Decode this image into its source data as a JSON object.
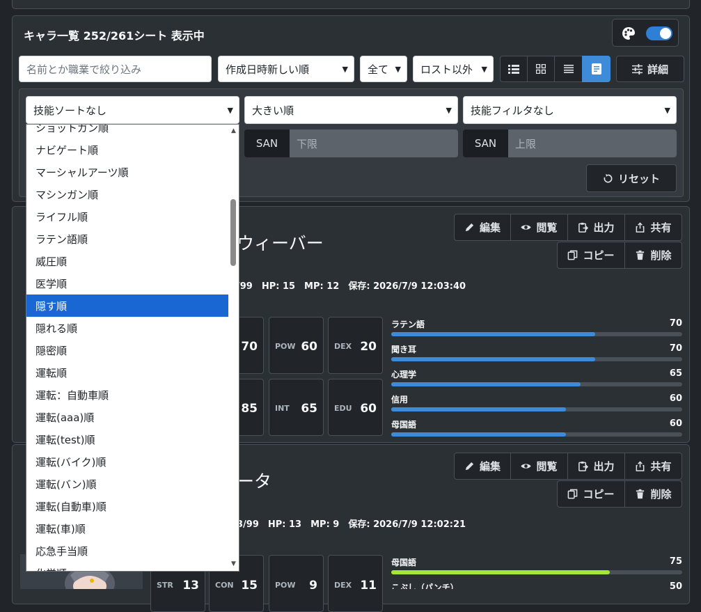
{
  "header": {
    "title": "キャラ一覧 252/261シート 表示中"
  },
  "toolbar": {
    "search_placeholder": "名前とか職業で絞り込み",
    "sort_order": "作成日時新しい順",
    "filter_all": "全て",
    "filter_lost": "ロスト以外",
    "detail_label": "詳細",
    "theme_toggle_on": true
  },
  "filters": {
    "skill_sort": "技能ソートなし",
    "size_order": "大きい順",
    "skill_filter": "技能フィルタなし",
    "san_label_min": "SAN",
    "san_min_placeholder": "下限",
    "san_label_max": "SAN",
    "san_max_placeholder": "上限",
    "reset_label": "リセット"
  },
  "dropdown": {
    "options": [
      "ショットガン順",
      "ナビゲート順",
      "マーシャルアーツ順",
      "マシンガン順",
      "ライフル順",
      "ラテン語順",
      "威圧順",
      "医学順",
      "隠す順",
      "隠れる順",
      "隠密順",
      "運転順",
      "運転：自動車順",
      "運転(aaa)順",
      "運転(test)順",
      "運転(バイク)順",
      "運転(バン)順",
      "運転(自動車)順",
      "運転(車)順",
      "応急手当順",
      "化学順"
    ],
    "selected_index": 8
  },
  "actions": {
    "edit": "編集",
    "view": "閲覧",
    "export": "出力",
    "share": "共有",
    "copy": "コピー",
    "delete": "削除"
  },
  "cards": [
    {
      "name_visible": "ウィーバー",
      "info": "/99　HP: 15　MP: 12　保存: 2026/7/9 12:03:40",
      "stats": [
        {
          "label": "",
          "value": "70"
        },
        {
          "label": "POW",
          "value": "60"
        },
        {
          "label": "DEX",
          "value": "20"
        },
        {
          "label": "",
          "value": "85"
        },
        {
          "label": "INT",
          "value": "65"
        },
        {
          "label": "EDU",
          "value": "60"
        }
      ],
      "skills": [
        {
          "name": "ラテン語",
          "value": 70,
          "color": "#3d8bd9"
        },
        {
          "name": "聞き耳",
          "value": 70,
          "color": "#3d8bd9"
        },
        {
          "name": "心理学",
          "value": 65,
          "color": "#3d8bd9"
        },
        {
          "name": "信用",
          "value": 60,
          "color": "#3d8bd9"
        },
        {
          "name": "母国語",
          "value": 60,
          "color": "#3d8bd9"
        }
      ]
    },
    {
      "name_visible": "ータ",
      "info": "3/99　HP: 13　MP: 9　保存: 2026/7/9 12:02:21",
      "stats": [
        {
          "label": "STR",
          "value": "13"
        },
        {
          "label": "CON",
          "value": "15"
        },
        {
          "label": "POW",
          "value": "9"
        },
        {
          "label": "DEX",
          "value": "11"
        }
      ],
      "skills": [
        {
          "name": "母国語",
          "value": 75,
          "color": "#a3e635"
        },
        {
          "name": "こぶし（パンチ）",
          "value": 50,
          "color": "#a3e635"
        }
      ]
    }
  ]
}
